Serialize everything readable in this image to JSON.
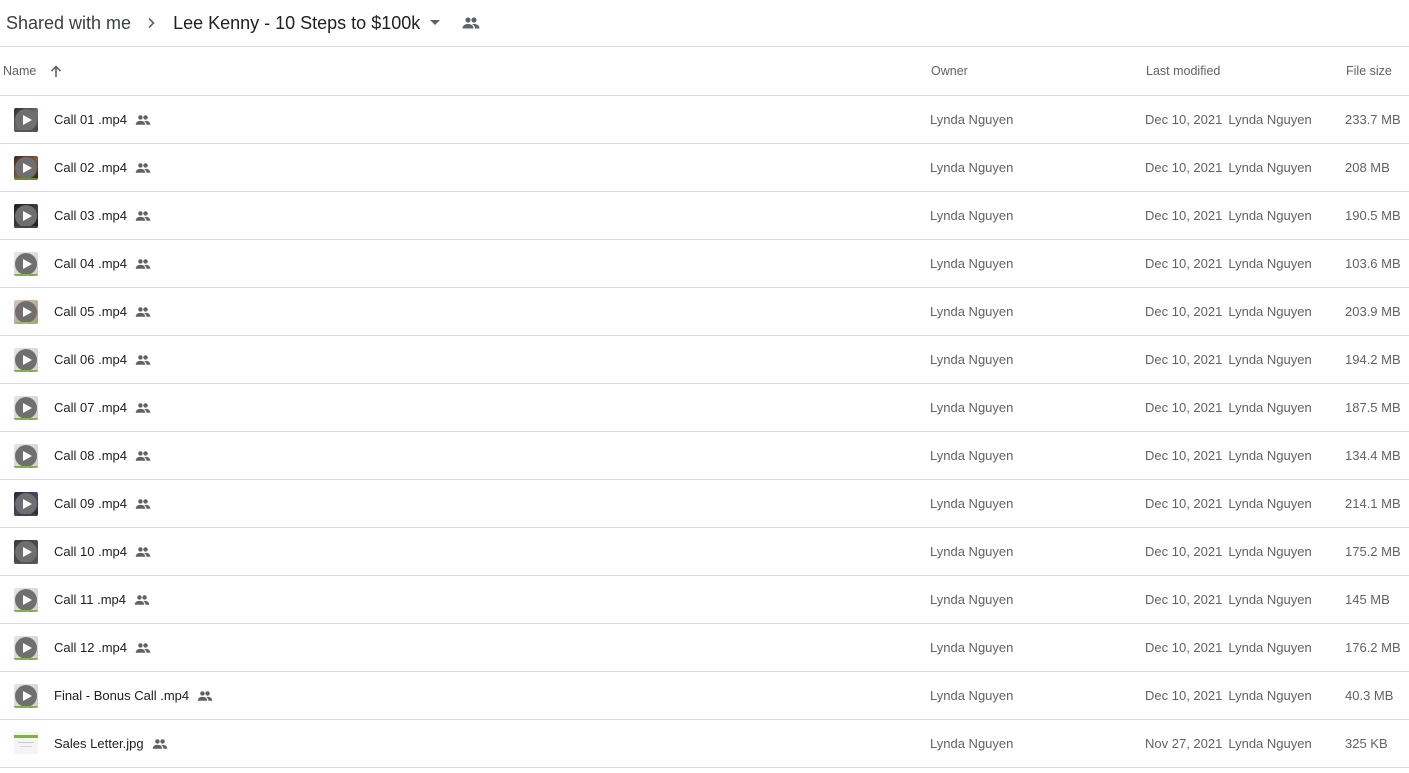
{
  "breadcrumb": {
    "root": "Shared with me",
    "current": "Lee Kenny - 10 Steps to $100k"
  },
  "columns": {
    "name": "Name",
    "owner": "Owner",
    "last_modified": "Last modified",
    "file_size": "File size"
  },
  "colors": {
    "divider": "#dadce0",
    "text_primary": "#202124",
    "text_secondary": "#5f6368",
    "icon_gray": "#5f6368"
  },
  "files": [
    {
      "name": "Call 01 .mp4",
      "owner": "Lynda Nguyen",
      "modified_date": "Dec 10, 2021",
      "modified_by": "Lynda Nguyen",
      "size": "233.7 MB",
      "type": "video"
    },
    {
      "name": "Call 02 .mp4",
      "owner": "Lynda Nguyen",
      "modified_date": "Dec 10, 2021",
      "modified_by": "Lynda Nguyen",
      "size": "208 MB",
      "type": "video"
    },
    {
      "name": "Call 03 .mp4",
      "owner": "Lynda Nguyen",
      "modified_date": "Dec 10, 2021",
      "modified_by": "Lynda Nguyen",
      "size": "190.5 MB",
      "type": "video"
    },
    {
      "name": "Call 04 .mp4",
      "owner": "Lynda Nguyen",
      "modified_date": "Dec 10, 2021",
      "modified_by": "Lynda Nguyen",
      "size": "103.6 MB",
      "type": "video"
    },
    {
      "name": "Call 05 .mp4",
      "owner": "Lynda Nguyen",
      "modified_date": "Dec 10, 2021",
      "modified_by": "Lynda Nguyen",
      "size": "203.9 MB",
      "type": "video"
    },
    {
      "name": "Call 06 .mp4",
      "owner": "Lynda Nguyen",
      "modified_date": "Dec 10, 2021",
      "modified_by": "Lynda Nguyen",
      "size": "194.2 MB",
      "type": "video"
    },
    {
      "name": "Call 07 .mp4",
      "owner": "Lynda Nguyen",
      "modified_date": "Dec 10, 2021",
      "modified_by": "Lynda Nguyen",
      "size": "187.5 MB",
      "type": "video"
    },
    {
      "name": "Call 08 .mp4",
      "owner": "Lynda Nguyen",
      "modified_date": "Dec 10, 2021",
      "modified_by": "Lynda Nguyen",
      "size": "134.4 MB",
      "type": "video"
    },
    {
      "name": "Call 09 .mp4",
      "owner": "Lynda Nguyen",
      "modified_date": "Dec 10, 2021",
      "modified_by": "Lynda Nguyen",
      "size": "214.1 MB",
      "type": "video"
    },
    {
      "name": "Call 10 .mp4",
      "owner": "Lynda Nguyen",
      "modified_date": "Dec 10, 2021",
      "modified_by": "Lynda Nguyen",
      "size": "175.2 MB",
      "type": "video"
    },
    {
      "name": "Call 11 .mp4",
      "owner": "Lynda Nguyen",
      "modified_date": "Dec 10, 2021",
      "modified_by": "Lynda Nguyen",
      "size": "145 MB",
      "type": "video"
    },
    {
      "name": "Call 12 .mp4",
      "owner": "Lynda Nguyen",
      "modified_date": "Dec 10, 2021",
      "modified_by": "Lynda Nguyen",
      "size": "176.2 MB",
      "type": "video"
    },
    {
      "name": "Final - Bonus Call .mp4",
      "owner": "Lynda Nguyen",
      "modified_date": "Dec 10, 2021",
      "modified_by": "Lynda Nguyen",
      "size": "40.3 MB",
      "type": "video"
    },
    {
      "name": "Sales Letter.jpg",
      "owner": "Lynda Nguyen",
      "modified_date": "Nov 27, 2021",
      "modified_by": "Lynda Nguyen",
      "size": "325 KB",
      "type": "image"
    }
  ]
}
